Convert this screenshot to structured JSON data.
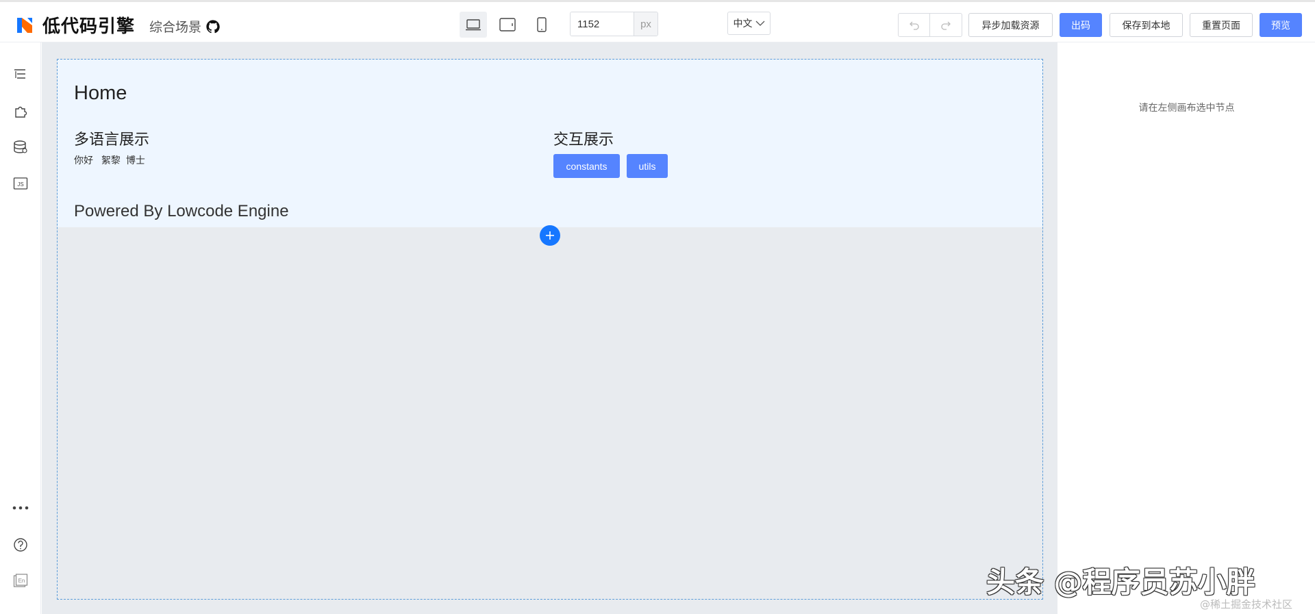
{
  "brand": {
    "title": "低代码引擎",
    "accent": "#5584ff",
    "logo_colors": [
      "#1677ff",
      "#ff6a00"
    ]
  },
  "scene": {
    "label": "综合场景",
    "icon": "github-icon"
  },
  "device": {
    "options": [
      "desktop-icon",
      "tablet-icon",
      "phone-icon"
    ],
    "active": "desktop"
  },
  "canvas_width": {
    "value": "1152",
    "unit": "px"
  },
  "locale": {
    "selected": "中文"
  },
  "toolbar": {
    "undo_icon": "undo-icon",
    "redo_icon": "redo-icon",
    "async_load_label": "异步加载资源",
    "export_code_label": "出码",
    "save_local_label": "保存到本地",
    "reset_page_label": "重置页面",
    "preview_label": "预览"
  },
  "leftbar": {
    "top_icons": [
      "outline-tree-icon",
      "component-puzzle-icon",
      "data-source-icon",
      "js-code-icon"
    ],
    "bottom_icons": [
      "more-icon",
      "help-icon",
      "language-en-icon"
    ]
  },
  "page": {
    "title": "Home",
    "i18n_section": {
      "title": "多语言展示",
      "words": [
        "你好",
        "絮黎",
        "博士"
      ]
    },
    "interaction_section": {
      "title": "交互展示",
      "buttons": [
        "constants",
        "utils"
      ]
    },
    "footer": "Powered By Lowcode Engine"
  },
  "settings_panel": {
    "hint": "请在左侧画布选中节点"
  },
  "watermark": {
    "main": "头条 @程序员苏小胖",
    "sub": "@稀土掘金技术社区"
  }
}
